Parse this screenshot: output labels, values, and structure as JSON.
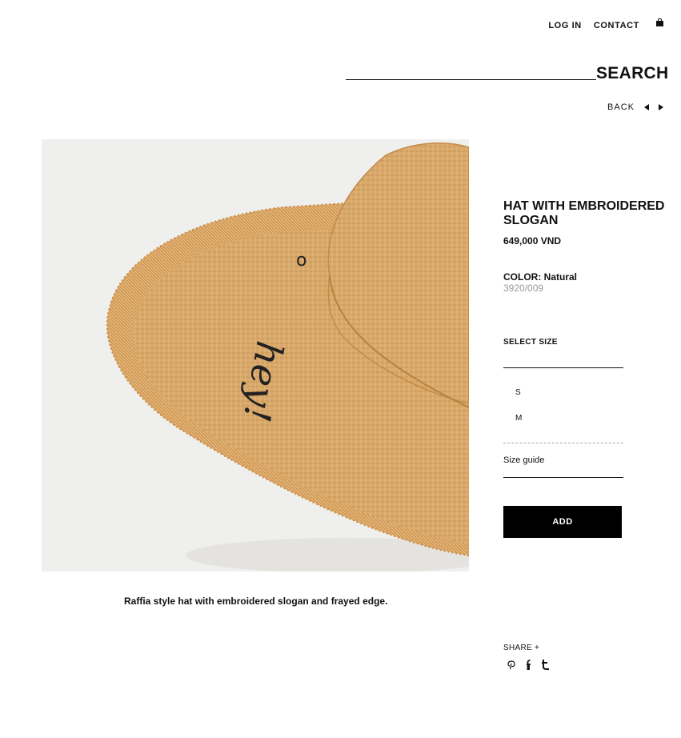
{
  "nav": {
    "login": "LOG IN",
    "contact": "CONTACT"
  },
  "search": {
    "label": "SEARCH"
  },
  "back": {
    "label": "BACK"
  },
  "product": {
    "title": "HAT WITH EMBROIDERED SLOGAN",
    "price": "649,000 VND",
    "color_label": "COLOR:",
    "color_value": "Natural",
    "ref": "3920/009",
    "select_size_label": "SELECT SIZE",
    "sizes": [
      "S",
      "M"
    ],
    "size_guide": "Size guide",
    "add_label": "ADD",
    "description": "Raffia style hat with embroidered slogan and frayed edge.",
    "image_slogan": "hey!"
  },
  "share": {
    "label": "SHARE +",
    "icons": [
      "pinterest-icon",
      "facebook-icon",
      "tumblr-icon"
    ]
  },
  "colors": {
    "text": "#111111",
    "button": "#000000",
    "image_bg": "#efefed",
    "raffia": "#d8a868"
  }
}
